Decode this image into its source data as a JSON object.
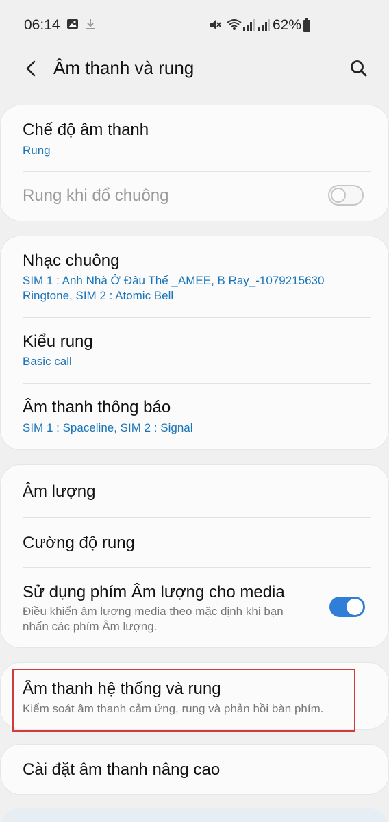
{
  "status_bar": {
    "time": "06:14",
    "battery": "62%",
    "icons": [
      "gallery-icon",
      "download-icon",
      "mute-icon",
      "wifi-icon",
      "signal-icon",
      "signal-icon",
      "battery-icon"
    ]
  },
  "header": {
    "title": "Âm thanh và rung",
    "back_icon": "back-arrow-icon",
    "search_icon": "search-icon"
  },
  "cards": {
    "sound_mode": {
      "title": "Chế độ âm thanh",
      "value": "Rung",
      "vibrate_ring_label": "Rung khi đổ chuông",
      "vibrate_ring_on": false
    },
    "ringtones": {
      "ringtone_title": "Nhạc chuông",
      "ringtone_line1": "SIM 1 : Anh Nhà Ở Đâu Thế _AMEE, B Ray_-1079215630",
      "ringtone_line2": "Ringtone, SIM 2 : Atomic Bell",
      "vibration_title": "Kiểu rung",
      "vibration_value": "Basic call",
      "notification_title": "Âm thanh thông báo",
      "notification_value": "SIM 1 : Spaceline, SIM 2 : Signal"
    },
    "volume": {
      "volume_title": "Âm lượng",
      "intensity_title": "Cường độ rung",
      "media_keys_title": "Sử dụng phím Âm lượng cho media",
      "media_keys_desc1": "Điều khiển âm lượng media theo mặc định khi bạn",
      "media_keys_desc2": "nhấn các phím Âm lượng.",
      "media_keys_on": true
    },
    "system": {
      "title": "Âm thanh hệ thống và rung",
      "desc": "Kiểm soát âm thanh cảm ứng, rung và phản hồi bàn phím."
    },
    "advanced": {
      "title": "Cài đặt âm thanh nâng cao"
    }
  },
  "colors": {
    "accent": "#1a74b8",
    "toggle_on": "#2f7fd8",
    "highlight": "#d23b3b",
    "background": "#f0f0f0"
  }
}
